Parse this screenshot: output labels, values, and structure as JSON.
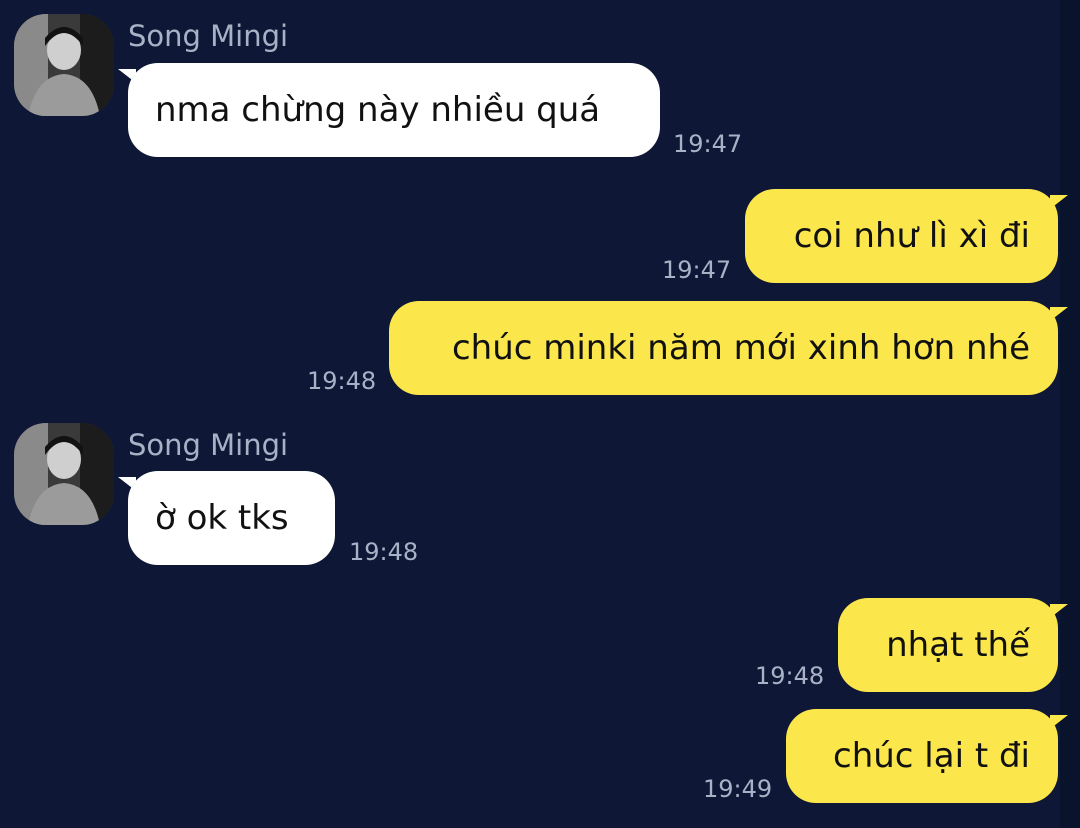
{
  "colors": {
    "background": "#0e1836",
    "incoming_bubble": "#ffffff",
    "outgoing_bubble": "#fbe74b",
    "meta_text": "#a9b1c6"
  },
  "messages": [
    {
      "direction": "incoming",
      "sender": "Song Mingi",
      "text": "nma chừng này nhiều quá",
      "time": "19:47"
    },
    {
      "direction": "outgoing",
      "text": "coi như lì xì đi",
      "time": "19:47"
    },
    {
      "direction": "outgoing",
      "text": "chúc minki năm mới xinh hơn nhé",
      "time": "19:48"
    },
    {
      "direction": "incoming",
      "sender": "Song Mingi",
      "text": "ờ ok tks",
      "time": "19:48"
    },
    {
      "direction": "outgoing",
      "text": "nhạt thế",
      "time": "19:48"
    },
    {
      "direction": "outgoing",
      "text": "chúc lại t đi",
      "time": "19:49"
    }
  ]
}
